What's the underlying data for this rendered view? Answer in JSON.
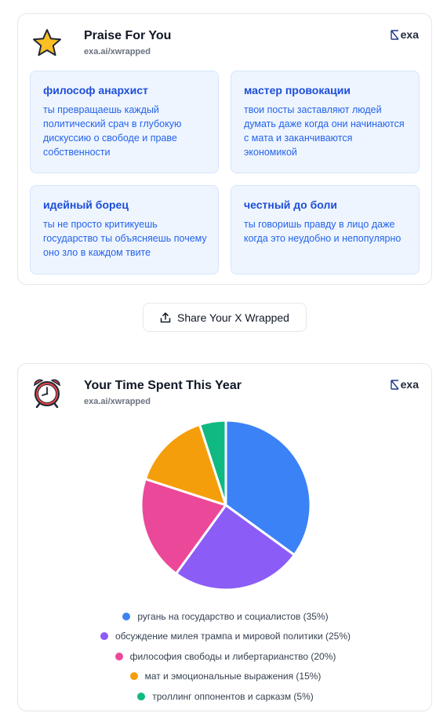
{
  "praise": {
    "title": "Praise For You",
    "subtitle": "exa.ai/xwrapped",
    "icon": "star-icon",
    "brand": "exa",
    "items": [
      {
        "title": "философ анархист",
        "text": "ты превращаешь каждый политический срач в глубокую дискуссию о свободе и праве собственности"
      },
      {
        "title": "мастер провокации",
        "text": "твои посты заставляют людей думать даже когда они начинаются с мата и заканчиваются экономикой"
      },
      {
        "title": "идейный борец",
        "text": "ты не просто критикуешь государство ты объясняешь почему оно зло в каждом твите"
      },
      {
        "title": "честный до боли",
        "text": "ты говоришь правду в лицо даже когда это неудобно и непопулярно"
      }
    ]
  },
  "share": {
    "label": "Share Your X Wrapped",
    "icon": "share-icon"
  },
  "time": {
    "title": "Your Time Spent This Year",
    "subtitle": "exa.ai/xwrapped",
    "icon": "alarm-clock-icon",
    "brand": "exa"
  },
  "chart_data": {
    "type": "pie",
    "title": "",
    "categories": [
      "ругань на государство и социалистов",
      "обсуждение милея трампа и мировой политики",
      "философия свободы и либертарианство",
      "мат и эмоциональные выражения",
      "троллинг оппонентов и сарказм"
    ],
    "values": [
      35,
      25,
      20,
      15,
      5
    ],
    "legend_labels": [
      "ругань на государство и социалистов (35%)",
      "обсуждение милея трампа и мировой политики (25%)",
      "философия свободы и либертарианство (20%)",
      "мат и эмоциональные выражения (15%)",
      "троллинг оппонентов и сарказм (5%)"
    ],
    "colors": [
      "#3b82f6",
      "#8b5cf6",
      "#ec4899",
      "#f59e0b",
      "#10b981"
    ],
    "legend_position": "bottom"
  }
}
